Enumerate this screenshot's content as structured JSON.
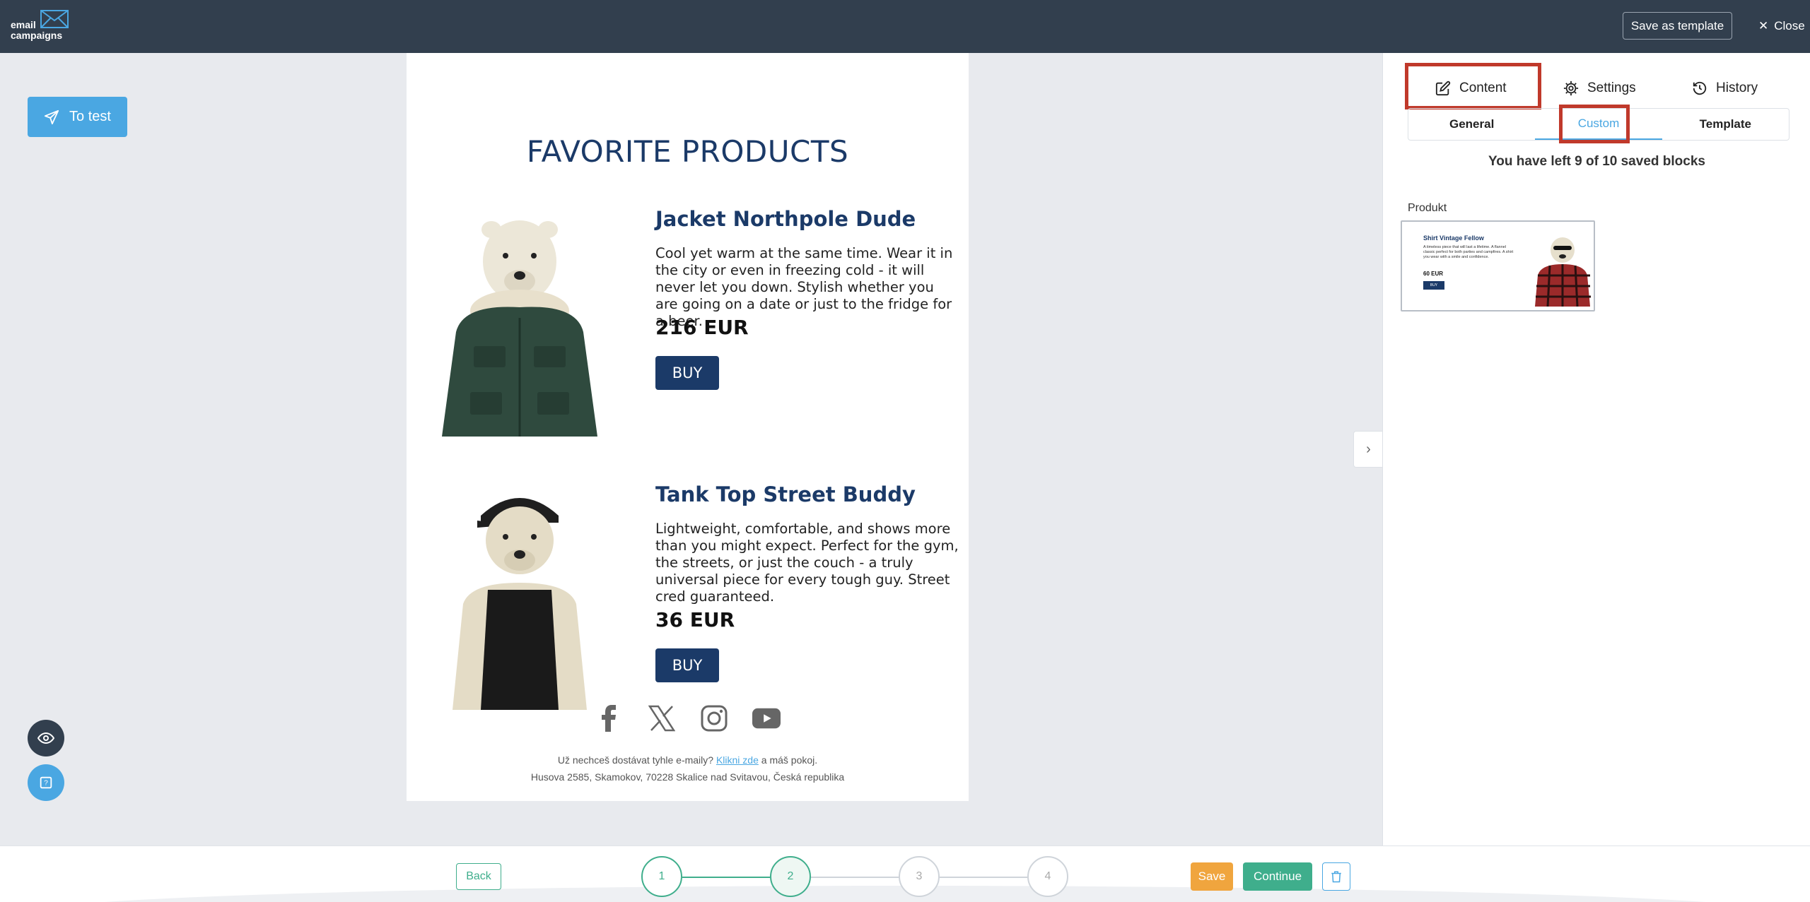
{
  "topbar": {
    "logo_line1": "email",
    "logo_line2": "campaigns",
    "save_template_label": "Save as template",
    "close_label": "Close"
  },
  "left": {
    "to_test_label": "To test"
  },
  "email": {
    "heading": "FAVORITE PRODUCTS",
    "products": [
      {
        "title": "Jacket Northpole Dude",
        "description": "Cool yet warm at the same time. Wear it in the city or even in freezing cold - it will never let you down. Stylish whether you are going on a date or just to the fridge for a beer.",
        "price": "216 EUR",
        "buy_label": "BUY"
      },
      {
        "title": "Tank Top Street Buddy",
        "description": "Lightweight, comfortable, and shows more than you might expect. Perfect for the gym, the streets, or just the couch - a truly universal piece for every tough guy. Street cred guaranteed.",
        "price": "36 EUR",
        "buy_label": "BUY"
      }
    ],
    "footer": {
      "unsubscribe_prefix": "Už nechceš dostávat tyhle e-maily?",
      "unsubscribe_link": "Klikni zde",
      "unsubscribe_suffix": "a máš pokoj.",
      "address": "Husova 2585, Skamokov, 70228 Skalice nad Svitavou, Česká republika"
    }
  },
  "panel": {
    "tabs": {
      "content": "Content",
      "settings": "Settings",
      "history": "History"
    },
    "subtabs": {
      "general": "General",
      "custom": "Custom",
      "template": "Template"
    },
    "saved_info": "You have left 9 of 10 saved blocks",
    "block_label": "Produkt",
    "block_preview": {
      "title": "Shirt Vintage Fellow",
      "description": "A timeless piece that will last a lifetime. A flannel classic perfect for both parties and campfires. A shirt you wear with a smile and confidence.",
      "price": "60 EUR",
      "buy": "BUY"
    }
  },
  "bottombar": {
    "back_label": "Back",
    "steps": [
      "1",
      "2",
      "3",
      "4"
    ],
    "current_step": 2,
    "save_label": "Save",
    "continue_label": "Continue"
  },
  "colors": {
    "topbar": "#323f4e",
    "accent_blue": "#4aa7e2",
    "navy": "#1b3a68",
    "green": "#3fae8c",
    "orange": "#f0a53e",
    "highlight_red": "#c0392b"
  }
}
